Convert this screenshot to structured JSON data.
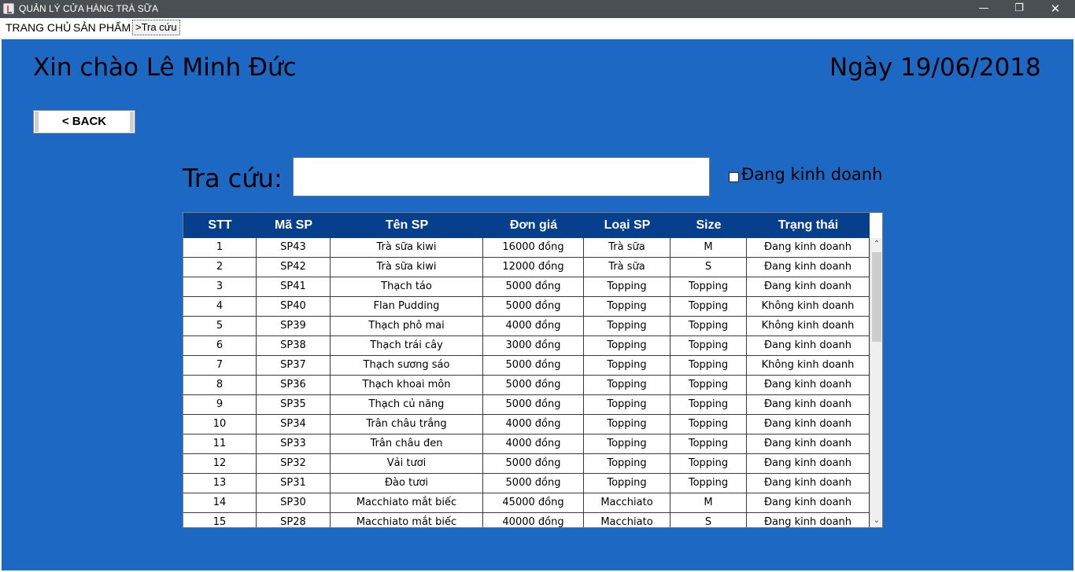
{
  "window": {
    "title": "QUẢN LÝ CỬA HÀNG TRÀ SỮA",
    "minimize": "—",
    "maximize": "❐",
    "close": "✕"
  },
  "menu": {
    "items": [
      "TRANG CHỦ",
      "SẢN PHẨM",
      ">Tra cứu"
    ]
  },
  "header": {
    "greeting": "Xin chào Lê Minh Đức",
    "date": "Ngày 19/06/2018"
  },
  "back_button": "< BACK",
  "search": {
    "label": "Tra cứu:",
    "value": "",
    "placeholder": ""
  },
  "filter": {
    "label": "Đang kinh doanh",
    "checked": false
  },
  "table": {
    "columns": [
      "STT",
      "Mã SP",
      "Tên SP",
      "Đơn giá",
      "Loại SP",
      "Size",
      "Trạng thái"
    ],
    "rows": [
      [
        "1",
        "SP43",
        "Trà sữa kiwi",
        "16000 đồng",
        "Trà sữa",
        "M",
        "Đang kinh doanh"
      ],
      [
        "2",
        "SP42",
        "Trà sữa kiwi",
        "12000 đồng",
        "Trà sữa",
        "S",
        "Đang kinh doanh"
      ],
      [
        "3",
        "SP41",
        "Thạch táo",
        "5000 đồng",
        "Topping",
        "Topping",
        "Đang kinh doanh"
      ],
      [
        "4",
        "SP40",
        "Flan Pudding",
        "5000 đồng",
        "Topping",
        "Topping",
        "Không kinh doanh"
      ],
      [
        "5",
        "SP39",
        "Thạch phô mai",
        "4000 đồng",
        "Topping",
        "Topping",
        "Không kinh doanh"
      ],
      [
        "6",
        "SP38",
        "Thạch trái cây",
        "3000 đồng",
        "Topping",
        "Topping",
        "Đang kinh doanh"
      ],
      [
        "7",
        "SP37",
        "Thạch sương sáo",
        "5000 đồng",
        "Topping",
        "Topping",
        "Không kinh doanh"
      ],
      [
        "8",
        "SP36",
        "Thạch khoai môn",
        "5000 đồng",
        "Topping",
        "Topping",
        "Đang kinh doanh"
      ],
      [
        "9",
        "SP35",
        "Thạch củ năng",
        "5000 đồng",
        "Topping",
        "Topping",
        "Đang kinh doanh"
      ],
      [
        "10",
        "SP34",
        "Trân châu trắng",
        "4000 đồng",
        "Topping",
        "Topping",
        "Đang kinh doanh"
      ],
      [
        "11",
        "SP33",
        "Trân châu đen",
        "4000 đồng",
        "Topping",
        "Topping",
        "Đang kinh doanh"
      ],
      [
        "12",
        "SP32",
        "Vải tươi",
        "5000 đồng",
        "Topping",
        "Topping",
        "Đang kinh doanh"
      ],
      [
        "13",
        "SP31",
        "Đào tươi",
        "5000 đồng",
        "Topping",
        "Topping",
        "Đang kinh doanh"
      ],
      [
        "14",
        "SP30",
        "Macchiato mắt biếc",
        "45000 đồng",
        "Macchiato",
        "M",
        "Đang kinh doanh"
      ],
      [
        "15",
        "SP28",
        "Macchiato mắt biếc",
        "40000 đồng",
        "Macchiato",
        "S",
        "Đang kinh doanh"
      ]
    ]
  },
  "scrollbar": {
    "up_glyph": "⌃",
    "down_glyph": "⌄"
  },
  "colors": {
    "panel_bg": "#1c68c3",
    "table_header_bg": "#053f8e",
    "titlebar_bg": "#4a4f54"
  }
}
